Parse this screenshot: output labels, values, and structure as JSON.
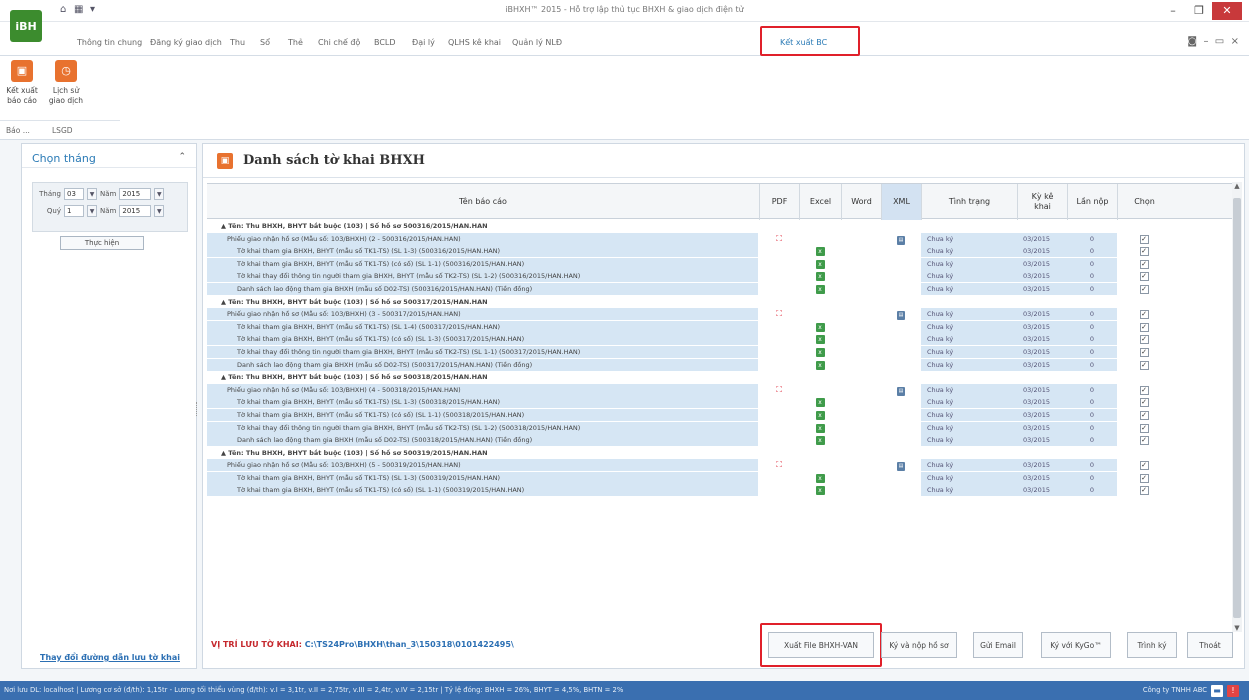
{
  "app": {
    "logo_text": "iBH",
    "title": "iBHXH™ 2015 - Hỗ trợ lập thủ tục BHXH & giao dịch điện tử"
  },
  "colors": {
    "accent": "#2b7bb6",
    "highlight": "#e0202a",
    "status_bar": "#3a6fb0",
    "row_fill": "#d6e6f4"
  },
  "tabs": [
    {
      "label": "Thông tin chung"
    },
    {
      "label": "Đăng ký giao dịch"
    },
    {
      "label": "Thu"
    },
    {
      "label": "Sổ"
    },
    {
      "label": "Thẻ"
    },
    {
      "label": "Chi chế độ"
    },
    {
      "label": "BCLD"
    },
    {
      "label": "Đại lý"
    },
    {
      "label": "QLHS kê khai"
    },
    {
      "label": "Quản lý NLĐ"
    },
    {
      "label": "Kết xuất BC"
    }
  ],
  "ribbon": {
    "btn1": "Kết xuất báo cáo",
    "btn2": "Lịch sử giao dịch",
    "group1": "Báo ...",
    "group2": "LSGD"
  },
  "left_panel": {
    "title": "Chọn tháng",
    "month_label": "Tháng",
    "month_value": "03",
    "year_label": "Năm",
    "year_value": "2015",
    "quarter_label": "Quý",
    "quarter_value": "1",
    "year2_value": "2015",
    "run_button": "Thực hiện",
    "change_path_link": "Thay đổi đường dẫn lưu tờ khai"
  },
  "main": {
    "title": "Danh sách tờ khai BHXH",
    "columns": {
      "name": "Tên báo cáo",
      "pdf": "PDF",
      "excel": "Excel",
      "word": "Word",
      "xml": "XML",
      "status": "Tình trạng",
      "period": "Kỳ kê khai",
      "times": "Lần nộp",
      "select": "Chọn"
    },
    "path_label": "VỊ TRÍ LƯU TỜ KHAI:",
    "path_value": "C:\\TS24Pro\\BHXH\\than_3\\150318\\0101422495\\",
    "buttons": {
      "export": "Xuất File BHXH-VAN",
      "sign_submit": "Ký và nộp hồ sơ",
      "email": "Gửi Email",
      "kygo": "Ký với KyGo™",
      "sign": "Trình ký",
      "exit": "Thoát"
    }
  },
  "grid": {
    "rows": [
      {
        "kind": "group",
        "name": "▲ Tên: Thu BHXH, BHYT bắt buộc (103) | Số hồ sơ 500316/2015/HAN.HAN"
      },
      {
        "kind": "detail",
        "indent": false,
        "pdf": true,
        "excel": false,
        "xml": true,
        "name": "Phiếu giao nhận hồ sơ (Mẫu số: 103/BHXH) (2 - 500316/2015/HAN.HAN)",
        "status": "Chưa ký",
        "period": "03/2015",
        "times": "0",
        "checked": true
      },
      {
        "kind": "detail",
        "indent": true,
        "pdf": false,
        "excel": true,
        "xml": false,
        "name": "Tờ khai tham gia BHXH, BHYT (mẫu số TK1-TS) (SL 1-3) (500316/2015/HAN.HAN)",
        "status": "Chưa ký",
        "period": "03/2015",
        "times": "0",
        "checked": true
      },
      {
        "kind": "detail",
        "indent": true,
        "pdf": false,
        "excel": true,
        "xml": false,
        "name": "Tờ khai tham gia BHXH, BHYT (mẫu số TK1-TS) (có số) (SL 1-1) (500316/2015/HAN.HAN)",
        "status": "Chưa ký",
        "period": "03/2015",
        "times": "0",
        "checked": true
      },
      {
        "kind": "detail",
        "indent": true,
        "pdf": false,
        "excel": true,
        "xml": false,
        "name": "Tờ khai thay đổi thông tin người tham gia BHXH, BHYT (mẫu số TK2-TS) (SL 1-2) (500316/2015/HAN.HAN)",
        "status": "Chưa ký",
        "period": "03/2015",
        "times": "0",
        "checked": true
      },
      {
        "kind": "detail",
        "indent": true,
        "pdf": false,
        "excel": true,
        "xml": false,
        "name": "Danh sách lao động tham gia BHXH (mẫu số D02-TS) (500316/2015/HAN.HAN) (Tiền đồng)",
        "status": "Chưa ký",
        "period": "03/2015",
        "times": "0",
        "checked": true
      },
      {
        "kind": "group",
        "name": "▲ Tên: Thu BHXH, BHYT bắt buộc (103) | Số hồ sơ 500317/2015/HAN.HAN"
      },
      {
        "kind": "detail",
        "indent": false,
        "pdf": true,
        "excel": false,
        "xml": true,
        "name": "Phiếu giao nhận hồ sơ (Mẫu số: 103/BHXH) (3 - 500317/2015/HAN.HAN)",
        "status": "Chưa ký",
        "period": "03/2015",
        "times": "0",
        "checked": true
      },
      {
        "kind": "detail",
        "indent": true,
        "pdf": false,
        "excel": true,
        "xml": false,
        "name": "Tờ khai tham gia BHXH, BHYT (mẫu số TK1-TS) (SL 1-4) (500317/2015/HAN.HAN)",
        "status": "Chưa ký",
        "period": "03/2015",
        "times": "0",
        "checked": true
      },
      {
        "kind": "detail",
        "indent": true,
        "pdf": false,
        "excel": true,
        "xml": false,
        "name": "Tờ khai tham gia BHXH, BHYT (mẫu số TK1-TS) (có số) (SL 1-3) (500317/2015/HAN.HAN)",
        "status": "Chưa ký",
        "period": "03/2015",
        "times": "0",
        "checked": true
      },
      {
        "kind": "detail",
        "indent": true,
        "pdf": false,
        "excel": true,
        "xml": false,
        "name": "Tờ khai thay đổi thông tin người tham gia BHXH, BHYT (mẫu số TK2-TS) (SL 1-1) (500317/2015/HAN.HAN)",
        "status": "Chưa ký",
        "period": "03/2015",
        "times": "0",
        "checked": true
      },
      {
        "kind": "detail",
        "indent": true,
        "pdf": false,
        "excel": true,
        "xml": false,
        "name": "Danh sách lao động tham gia BHXH (mẫu số D02-TS) (500317/2015/HAN.HAN) (Tiền đồng)",
        "status": "Chưa ký",
        "period": "03/2015",
        "times": "0",
        "checked": true
      },
      {
        "kind": "group",
        "name": "▲ Tên: Thu BHXH, BHYT bắt buộc (103) | Số hồ sơ 500318/2015/HAN.HAN"
      },
      {
        "kind": "detail",
        "indent": false,
        "pdf": true,
        "excel": false,
        "xml": true,
        "name": "Phiếu giao nhận hồ sơ (Mẫu số: 103/BHXH) (4 - 500318/2015/HAN.HAN)",
        "status": "Chưa ký",
        "period": "03/2015",
        "times": "0",
        "checked": true
      },
      {
        "kind": "detail",
        "indent": true,
        "pdf": false,
        "excel": true,
        "xml": false,
        "name": "Tờ khai tham gia BHXH, BHYT (mẫu số TK1-TS) (SL 1-3) (500318/2015/HAN.HAN)",
        "status": "Chưa ký",
        "period": "03/2015",
        "times": "0",
        "checked": true
      },
      {
        "kind": "detail",
        "indent": true,
        "pdf": false,
        "excel": true,
        "xml": false,
        "name": "Tờ khai tham gia BHXH, BHYT (mẫu số TK1-TS) (có số) (SL 1-1) (500318/2015/HAN.HAN)",
        "status": "Chưa ký",
        "period": "03/2015",
        "times": "0",
        "checked": true
      },
      {
        "kind": "detail",
        "indent": true,
        "pdf": false,
        "excel": true,
        "xml": false,
        "name": "Tờ khai thay đổi thông tin người tham gia BHXH, BHYT (mẫu số TK2-TS) (SL 1-2) (500318/2015/HAN.HAN)",
        "status": "Chưa ký",
        "period": "03/2015",
        "times": "0",
        "checked": true
      },
      {
        "kind": "detail",
        "indent": true,
        "pdf": false,
        "excel": true,
        "xml": false,
        "name": "Danh sách lao động tham gia BHXH (mẫu số D02-TS) (500318/2015/HAN.HAN) (Tiền đồng)",
        "status": "Chưa ký",
        "period": "03/2015",
        "times": "0",
        "checked": true
      },
      {
        "kind": "group",
        "name": "▲ Tên: Thu BHXH, BHYT bắt buộc (103) | Số hồ sơ 500319/2015/HAN.HAN"
      },
      {
        "kind": "detail",
        "indent": false,
        "pdf": true,
        "excel": false,
        "xml": true,
        "name": "Phiếu giao nhận hồ sơ (Mẫu số: 103/BHXH) (5 - 500319/2015/HAN.HAN)",
        "status": "Chưa ký",
        "period": "03/2015",
        "times": "0",
        "checked": true
      },
      {
        "kind": "detail",
        "indent": true,
        "pdf": false,
        "excel": true,
        "xml": false,
        "name": "Tờ khai tham gia BHXH, BHYT (mẫu số TK1-TS) (SL 1-3) (500319/2015/HAN.HAN)",
        "status": "Chưa ký",
        "period": "03/2015",
        "times": "0",
        "checked": true
      },
      {
        "kind": "detail",
        "indent": true,
        "pdf": false,
        "excel": true,
        "xml": false,
        "name": "Tờ khai tham gia BHXH, BHYT (mẫu số TK1-TS) (có số) (SL 1-1) (500319/2015/HAN.HAN)",
        "status": "Chưa ký",
        "period": "03/2015",
        "times": "0",
        "checked": true
      }
    ]
  },
  "status_bar": {
    "text": "Nơi lưu DL: localhost | Lương cơ sở (đ/th): 1,15tr - Lương tối thiểu vùng (đ/th): v.I = 3,1tr, v.II = 2,75tr, v.III = 2,4tr, v.IV = 2,15tr | Tỷ lệ đóng: BHXH = 26%, BHYT = 4,5%, BHTN = 2%",
    "company": "Công ty TNHH ABC"
  }
}
